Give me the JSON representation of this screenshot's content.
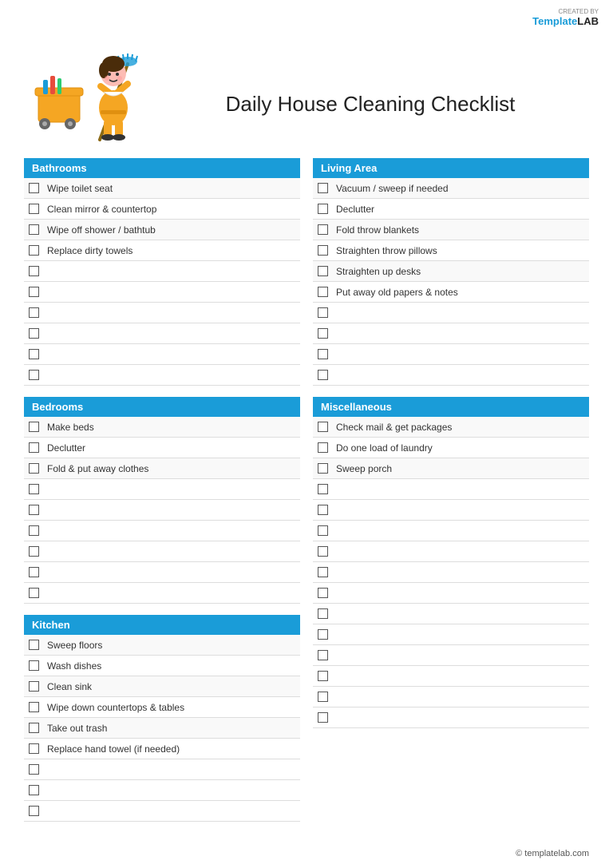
{
  "logo": {
    "created_by": "CREATED BY",
    "brand_template": "Template",
    "brand_lab": "LAB"
  },
  "title": "Daily House Cleaning Checklist",
  "sections": {
    "bathrooms": {
      "label": "Bathrooms",
      "items": [
        "Wipe toilet seat",
        "Clean mirror & countertop",
        "Wipe off shower / bathtub",
        "Replace dirty towels",
        "",
        "",
        "",
        "",
        "",
        ""
      ]
    },
    "bedrooms": {
      "label": "Bedrooms",
      "items": [
        "Make beds",
        "Declutter",
        "Fold & put away clothes",
        "",
        "",
        "",
        "",
        "",
        ""
      ]
    },
    "kitchen": {
      "label": "Kitchen",
      "items": [
        "Sweep floors",
        "Wash dishes",
        "Clean sink",
        "Wipe down countertops & tables",
        "Take out trash",
        "Replace hand towel (if needed)",
        "",
        "",
        ""
      ]
    },
    "living_area": {
      "label": "Living Area",
      "items": [
        "Vacuum / sweep if needed",
        "Declutter",
        "Fold throw blankets",
        "Straighten throw pillows",
        "Straighten up desks",
        "Put away old papers & notes",
        "",
        "",
        "",
        ""
      ]
    },
    "miscellaneous": {
      "label": "Miscellaneous",
      "items": [
        "Check mail & get packages",
        "Do one load of laundry",
        "Sweep porch",
        "",
        "",
        "",
        "",
        "",
        "",
        "",
        "",
        ""
      ]
    }
  },
  "footer": "© templatelab.com"
}
